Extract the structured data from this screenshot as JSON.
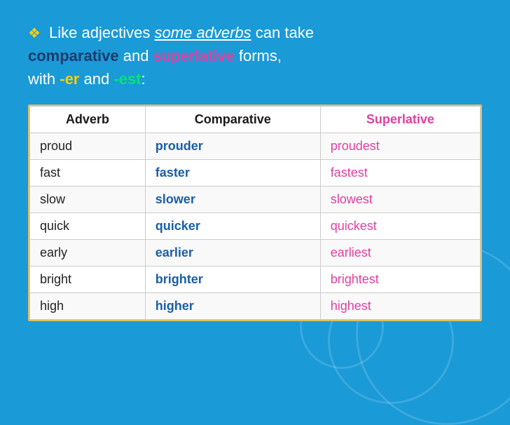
{
  "intro": {
    "diamond": "❖",
    "line1_pre": " Like adjectives ",
    "line1_underline": "some adverbs",
    "line1_post": " can take",
    "line2_bold1": "comparative",
    "line2_mid": " and ",
    "line2_bold2": "superlative",
    "line2_post": " forms,",
    "line3_pre": "with ",
    "line3_er": "-er",
    "line3_mid": " and ",
    "line3_est": "-est",
    "line3_post": ":"
  },
  "table": {
    "headers": [
      "Adverb",
      "Comparative",
      "Superlative"
    ],
    "rows": [
      [
        "proud",
        "prouder",
        "proudest"
      ],
      [
        "fast",
        "faster",
        "fastest"
      ],
      [
        "slow",
        "slower",
        "slowest"
      ],
      [
        "quick",
        "quicker",
        "quickest"
      ],
      [
        "early",
        "earlier",
        "earliest"
      ],
      [
        "bright",
        "brighter",
        "brightest"
      ],
      [
        "high",
        "higher",
        "highest"
      ]
    ]
  }
}
